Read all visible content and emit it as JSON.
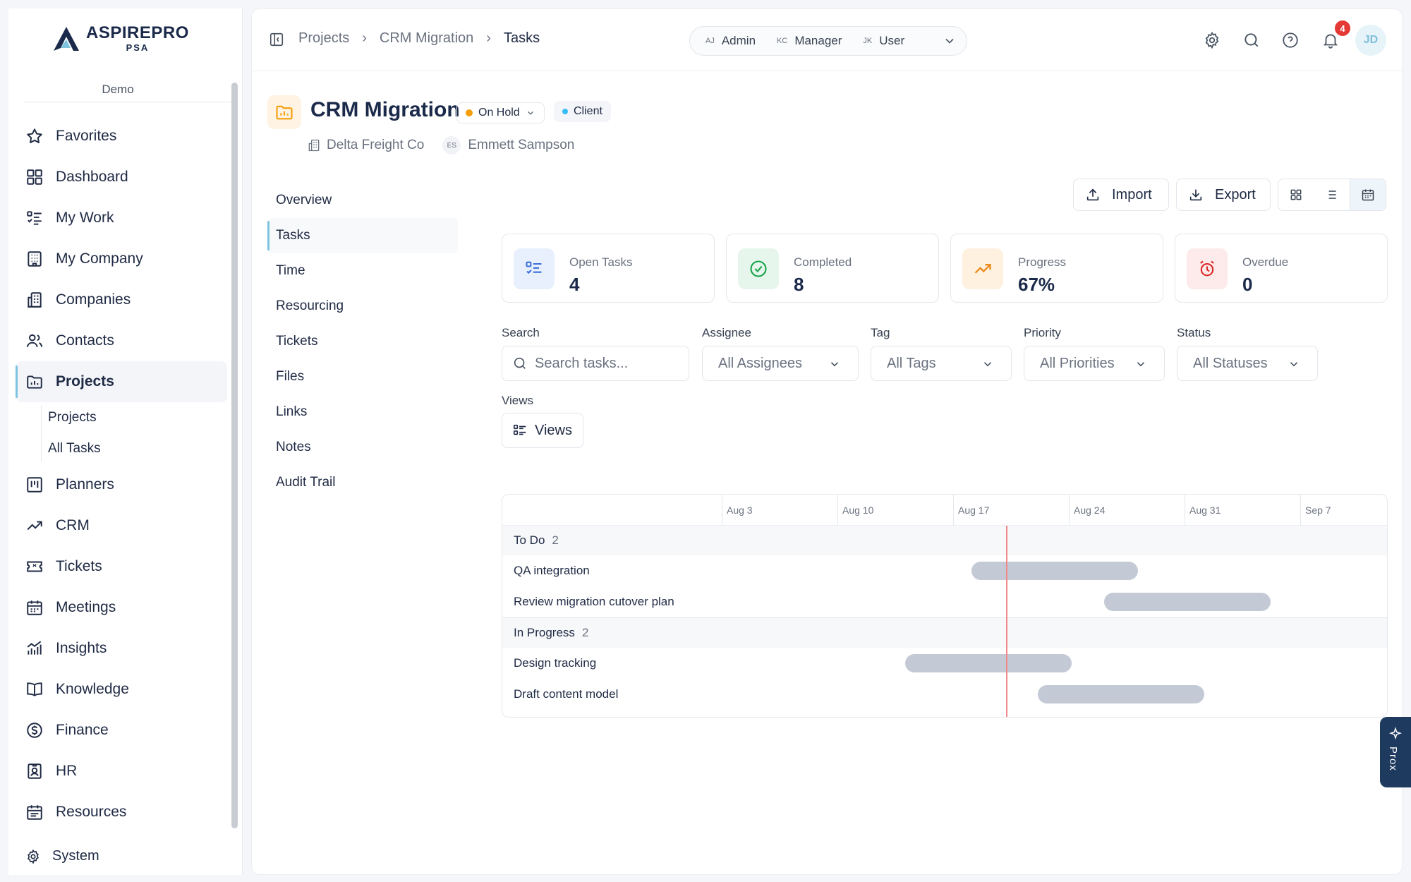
{
  "brand": {
    "name": "ASPIREPRO",
    "sub": "PSA",
    "org": "Demo"
  },
  "sidebar": {
    "items": [
      {
        "label": "Favorites",
        "icon": "star-icon"
      },
      {
        "label": "Dashboard",
        "icon": "grid-icon"
      },
      {
        "label": "My Work",
        "icon": "task-list-icon"
      },
      {
        "label": "My Company",
        "icon": "building-icon"
      },
      {
        "label": "Companies",
        "icon": "buildings-icon"
      },
      {
        "label": "Contacts",
        "icon": "users-icon"
      },
      {
        "label": "Projects",
        "icon": "folder-chart-icon",
        "active": true
      },
      {
        "label": "Planners",
        "icon": "kanban-icon"
      },
      {
        "label": "CRM",
        "icon": "trend-icon"
      },
      {
        "label": "Tickets",
        "icon": "ticket-icon"
      },
      {
        "label": "Meetings",
        "icon": "calendar-icon"
      },
      {
        "label": "Insights",
        "icon": "bar-chart-icon"
      },
      {
        "label": "Knowledge",
        "icon": "book-icon"
      },
      {
        "label": "Finance",
        "icon": "dollar-icon"
      },
      {
        "label": "HR",
        "icon": "id-badge-icon"
      },
      {
        "label": "Resources",
        "icon": "calendar-list-icon"
      }
    ],
    "subitems": [
      "Projects",
      "All Tasks"
    ],
    "system": "System"
  },
  "topbar": {
    "breadcrumb": [
      "Projects",
      "CRM Migration",
      "Tasks"
    ],
    "roles": [
      {
        "initials": "AJ",
        "label": "Admin"
      },
      {
        "initials": "KC",
        "label": "Manager"
      },
      {
        "initials": "JK",
        "label": "User"
      }
    ],
    "notifications": "4",
    "avatar": "JD"
  },
  "project": {
    "title": "CRM Migration",
    "status": "On Hold",
    "type": "Client",
    "company": "Delta Freight Co",
    "owner_initials": "ES",
    "owner": "Emmett Sampson"
  },
  "subnav": [
    "Overview",
    "Tasks",
    "Time",
    "Resourcing",
    "Tickets",
    "Files",
    "Links",
    "Notes",
    "Audit Trail"
  ],
  "actions": {
    "import": "Import",
    "export": "Export"
  },
  "stats": [
    {
      "label": "Open Tasks",
      "value": "4",
      "color": "#3b6fd8",
      "bg": "#e8f0fd"
    },
    {
      "label": "Completed",
      "value": "8",
      "color": "#16a34a",
      "bg": "#e6f6ec"
    },
    {
      "label": "Progress",
      "value": "67%",
      "color": "#ea8a1a",
      "bg": "#fff1e0"
    },
    {
      "label": "Overdue",
      "value": "0",
      "color": "#dc2626",
      "bg": "#fdeaea"
    }
  ],
  "filters": {
    "search_label": "Search",
    "search_placeholder": "Search tasks...",
    "assignee_label": "Assignee",
    "assignee": "All Assignees",
    "tag_label": "Tag",
    "tag": "All Tags",
    "priority_label": "Priority",
    "priority": "All Priorities",
    "status_label": "Status",
    "status": "All Statuses",
    "views_label": "Views",
    "views": "Views"
  },
  "gantt": {
    "weeks": [
      "Aug 3",
      "Aug 10",
      "Aug 17",
      "Aug 24",
      "Aug 31",
      "Sep 7"
    ],
    "groups": [
      {
        "name": "To Do",
        "count": "2",
        "tasks": [
          "QA integration",
          "Review migration cutover plan"
        ]
      },
      {
        "name": "In Progress",
        "count": "2",
        "tasks": [
          "Design tracking",
          "Draft content model"
        ]
      }
    ]
  },
  "assistant": {
    "label": "Prox"
  }
}
